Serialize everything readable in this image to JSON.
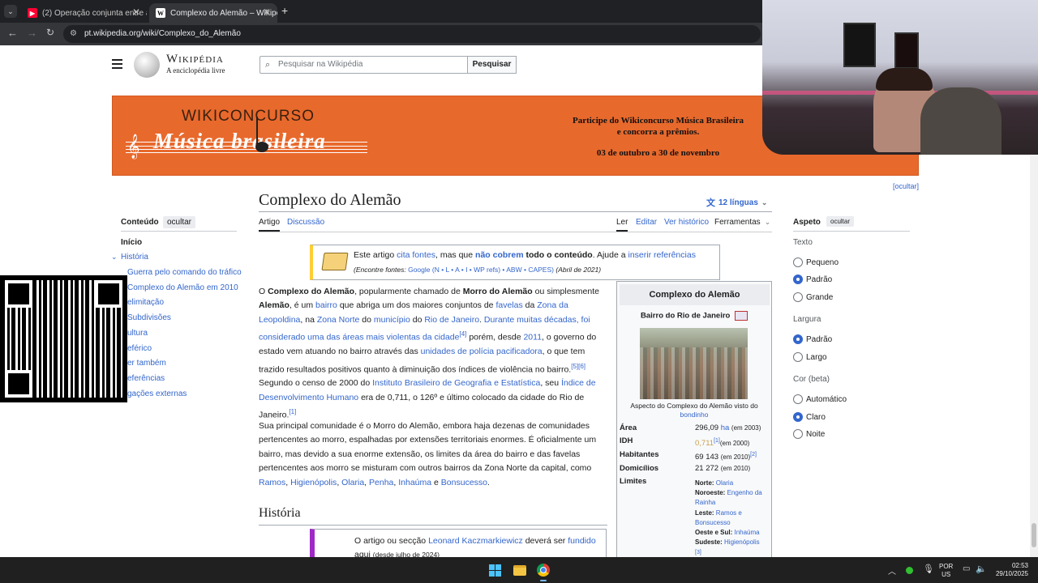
{
  "browser": {
    "tabs": [
      {
        "title": "(2) Operação conjunta entre a P",
        "favicon": "youtube-icon"
      },
      {
        "title": "Complexo do Alemão – Wikipé",
        "favicon": "wikipedia-icon"
      }
    ],
    "new_tab_symbol": "+",
    "url": "pt.wikipedia.org/wiki/Complexo_do_Alemão"
  },
  "wiki": {
    "wordmark": "Wikipédia",
    "tagline": "A enciclopédia livre",
    "search_placeholder": "Pesquisar na Wikipédia",
    "search_button": "Pesquisar",
    "banner": {
      "brand_line1": "WIKICONCURSO",
      "brand_line2": "Música brasileira",
      "text1": "Participe do Wikiconcurso Música Brasileira",
      "text2": "e concorra a prêmios.",
      "dates": "03 de outubro a 30 de novembro"
    },
    "hide_banner": "[ocultar]",
    "title": "Complexo do Alemão",
    "languages": "12 línguas",
    "tabs_left": [
      "Artigo",
      "Discussão"
    ],
    "tabs_right": [
      "Ler",
      "Editar",
      "Ver histórico",
      "Ferramentas"
    ],
    "toc": {
      "heading": "Conteúdo",
      "hide": "ocultar",
      "items": [
        "Início",
        "História",
        "Guerra pelo comando do tráfico",
        "Complexo do Alemão em 2010",
        "elimitação",
        "Subdivisões",
        "ultura",
        "eférico",
        "er também",
        "eferências",
        "gações externas"
      ]
    },
    "notice": {
      "t1": "Este artigo ",
      "l1": "cita fontes",
      "t2": ", mas que ",
      "l2": "não cobrem",
      "t3": " todo o conteúdo",
      "t4": ". Ajude a ",
      "l3": "inserir referências",
      "sub_label": "(Encontre fontes: ",
      "sub_links": "Google (N • L • A • I • WP refs)  • ABW  • CAPES)",
      "sub_date": "(Abril de 2021)"
    },
    "para1": {
      "a": "O ",
      "b": "Complexo do Alemão",
      "c": ", popularmente chamado de ",
      "d": "Morro do Alemão",
      "e": " ou simplesmente ",
      "f": "Alemão",
      "g": ", é um ",
      "l_bairro": "bairro",
      "h": " que abriga um dos maiores conjuntos de ",
      "l_favelas": "favelas",
      "i": " da ",
      "l_zona": "Zona da Leopoldina",
      "j": ", na ",
      "l_norte": "Zona Norte",
      "k": " do ",
      "l_mun": "município",
      "m": " do ",
      "l_rio": "Rio de Janeiro",
      "n": ". ",
      "l_dur": "Durante muitas décadas, foi considerado uma das áreas mais",
      "o": " ",
      "l_viol": "violentas da cidade",
      "ref4": "[4]",
      "p": " porém, desde ",
      "l_2011": "2011",
      "q": ", o governo do estado vem atuando no bairro através das ",
      "l_upp": "unidades de polícia pacificadora",
      "r": ", o que tem trazido resultados positivos quanto à diminuição dos índices de violência no bairro.",
      "ref56": "[5][6]",
      "s": " Segundo o censo de 2000 do ",
      "l_ibge": "Instituto Brasileiro de Geografia e Estatística",
      "t": ", seu ",
      "l_idh": "Índice de Desenvolvimento Humano",
      "u": " era de 0,711, o 126º e último colocado da cidade do Rio de Janeiro.",
      "ref1": "[1]"
    },
    "para2": {
      "a": "Sua principal comunidade é o Morro do Alemão, embora haja dezenas de comunidades pertencentes ao morro, espalhadas por extensões territoriais enormes. É oficialmente um bairro, mas devido a sua enorme extensão, os limites da área do bairro e das favelas pertencentes aos morro se misturam com outros bairros da Zona Norte da capital, como ",
      "l1": "Ramos",
      "l2": "Higienópolis",
      "l3": "Olaria",
      "l4": "Penha",
      "l5": "Inhaúma",
      "and": " e ",
      "l6": "Bonsucesso",
      "end": "."
    },
    "section_title": "História",
    "notice2": {
      "t1": "O artigo ou secção ",
      "l1": "Leonard Kaczmarkiewicz",
      "t2": " deverá ser ",
      "l2": "fundido",
      "t3": "aqui",
      "t4": "(desde julho de 2024)"
    },
    "infobox": {
      "title": "Complexo do Alemão",
      "subtitle": "Bairro do Rio de Janeiro",
      "caption": "Aspecto do Complexo do Alemão visto do",
      "caption_link": "bondinho",
      "rows": [
        {
          "k": "Área",
          "v": "296,09",
          "vl": "ha",
          "vs": "(em 2003)"
        },
        {
          "k": "IDH",
          "v": "0,711",
          "vl": "[1]",
          "vs": "(em 2000)"
        },
        {
          "k": "Habitantes",
          "v": "69 143",
          "vl": "[2]",
          "vs": "(em 2010)"
        },
        {
          "k": "Domicílios",
          "v": "21 272",
          "vl": "",
          "vs": "(em 2010)"
        }
      ],
      "limits_label": "Limites",
      "limits": [
        {
          "k": "Norte:",
          "v": "Olaria"
        },
        {
          "k": "Noroeste:",
          "v": "Engenho da Rainha"
        },
        {
          "k": "Leste:",
          "v": "Ramos e Bonsucesso"
        },
        {
          "k": "Oeste e Sul:",
          "v": "Inhaúma"
        },
        {
          "k": "Sudeste:",
          "v": "Higienópolis"
        }
      ],
      "limits_ref": "[3]"
    },
    "appearance": {
      "heading": "Aspeto",
      "hide": "ocultar",
      "text_label": "Texto",
      "text_options": [
        "Pequeno",
        "Padrão",
        "Grande"
      ],
      "text_selected": 1,
      "width_label": "Largura",
      "width_options": [
        "Padrão",
        "Largo"
      ],
      "width_selected": 0,
      "color_label": "Cor (beta)",
      "color_options": [
        "Automático",
        "Claro",
        "Noite"
      ],
      "color_selected": 1
    }
  },
  "taskbar": {
    "lang1": "POR",
    "lang2": "US",
    "time": "02:53",
    "date": "29/10/2025"
  },
  "colors": {
    "wiki_link": "#3366cc",
    "banner": "#e8692c",
    "notice_border": "#fc3",
    "notice2_border": "#a029c5"
  }
}
